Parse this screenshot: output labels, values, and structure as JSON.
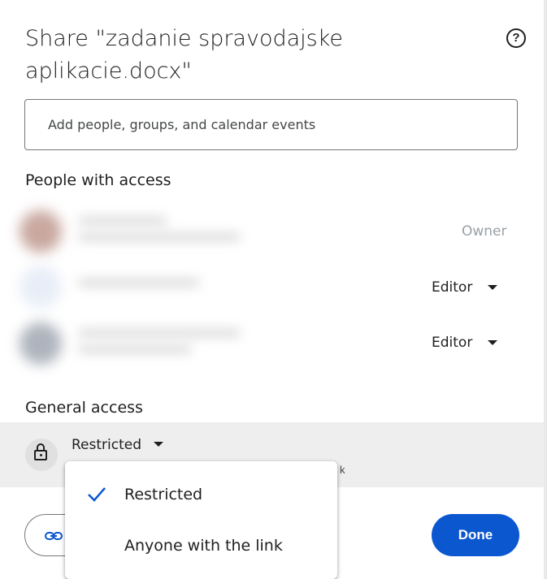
{
  "dialog": {
    "title": "Share \"zadanie spravodajske aplikacie.docx\"",
    "help_icon": "help-circle-icon"
  },
  "add_people": {
    "placeholder": "Add people, groups, and calendar events"
  },
  "people_section": {
    "heading": "People with access",
    "people": [
      {
        "role": "Owner"
      },
      {
        "role": "Editor"
      },
      {
        "role": "Editor"
      }
    ]
  },
  "general_access": {
    "heading": "General access",
    "selected": "Restricted",
    "partial_text_behind_menu": "k"
  },
  "dropdown_menu": {
    "items": [
      {
        "label": "Restricted",
        "checked": true
      },
      {
        "label": "Anyone with the link",
        "checked": false
      }
    ]
  },
  "footer": {
    "copy_link_icon": "link-icon",
    "done_label": "Done"
  },
  "colors": {
    "accent": "#0b57d0",
    "check": "#0b57d0",
    "general_bg": "#eeeeee"
  }
}
